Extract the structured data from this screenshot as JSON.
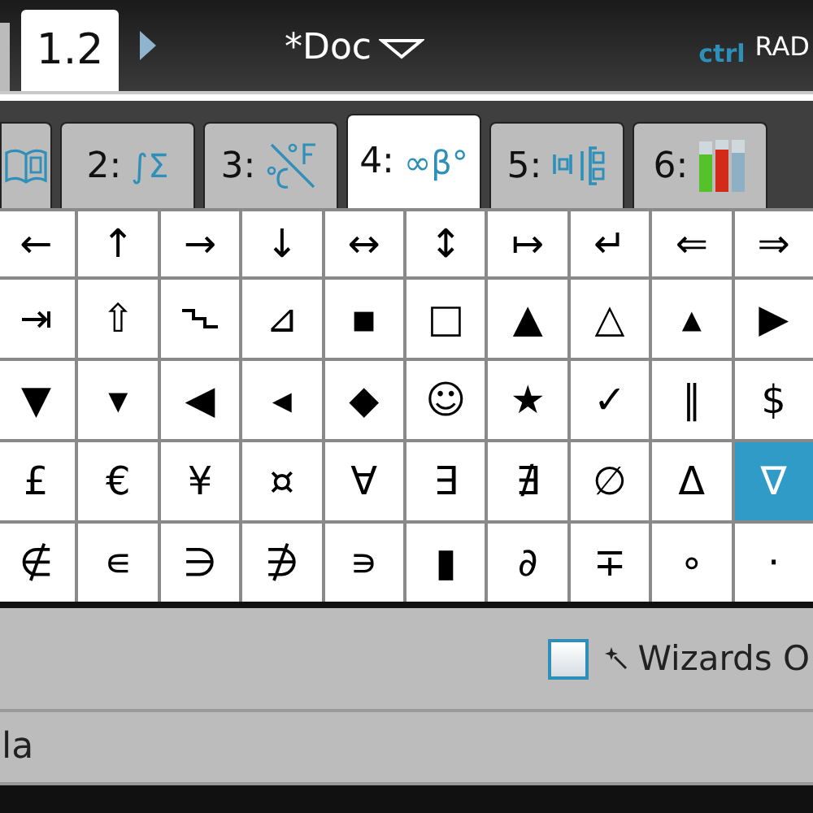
{
  "top_bar": {
    "page_tab": "1.2",
    "document_title": "*Doc",
    "modifier": "ctrl",
    "angle_mode": "RAD"
  },
  "category_tabs": [
    {
      "kind": "book",
      "selected": false
    },
    {
      "kind": "text",
      "number": "2:",
      "symbol": "∫Σ",
      "selected": false
    },
    {
      "kind": "units",
      "number": "3:",
      "selected": false
    },
    {
      "kind": "text",
      "number": "4:",
      "symbol": "∞β°",
      "selected": true
    },
    {
      "kind": "matrix",
      "number": "5:",
      "selected": false
    },
    {
      "kind": "library",
      "number": "6:",
      "selected": false
    }
  ],
  "symbol_grid": [
    [
      {
        "kind": "char",
        "text": "←",
        "selected": false
      },
      {
        "kind": "char",
        "text": "↑",
        "selected": false
      },
      {
        "kind": "char",
        "text": "→",
        "selected": false
      },
      {
        "kind": "char",
        "text": "↓",
        "selected": false
      },
      {
        "kind": "char",
        "text": "↔",
        "selected": false
      },
      {
        "kind": "char",
        "text": "↕",
        "selected": false
      },
      {
        "kind": "char",
        "text": "↦",
        "selected": false
      },
      {
        "kind": "char",
        "text": "↵",
        "selected": false
      },
      {
        "kind": "char",
        "text": "⇐",
        "selected": false
      },
      {
        "kind": "char",
        "text": "⇒",
        "selected": false
      }
    ],
    [
      {
        "kind": "char",
        "text": "⇥",
        "selected": false
      },
      {
        "kind": "char",
        "text": "⇧",
        "selected": false
      },
      {
        "kind": "step",
        "selected": false
      },
      {
        "kind": "char",
        "text": "⊿",
        "selected": false
      },
      {
        "kind": "char",
        "text": "▪",
        "selected": false
      },
      {
        "kind": "char",
        "text": "□",
        "selected": false
      },
      {
        "kind": "char",
        "text": "▲",
        "selected": false
      },
      {
        "kind": "char",
        "text": "△",
        "selected": false
      },
      {
        "kind": "char",
        "text": "▴",
        "selected": false
      },
      {
        "kind": "char",
        "text": "▶",
        "selected": false
      }
    ],
    [
      {
        "kind": "char",
        "text": "▼",
        "selected": false
      },
      {
        "kind": "char",
        "text": "▾",
        "selected": false
      },
      {
        "kind": "char",
        "text": "◀",
        "selected": false
      },
      {
        "kind": "char",
        "text": "◂",
        "selected": false
      },
      {
        "kind": "char",
        "text": "◆",
        "selected": false
      },
      {
        "kind": "char",
        "text": "☺",
        "selected": false
      },
      {
        "kind": "char",
        "text": "★",
        "selected": false
      },
      {
        "kind": "char",
        "text": "✓",
        "selected": false
      },
      {
        "kind": "char",
        "text": "∥",
        "selected": false
      },
      {
        "kind": "char",
        "text": "$",
        "selected": false
      }
    ],
    [
      {
        "kind": "char",
        "text": "£",
        "selected": false
      },
      {
        "kind": "char",
        "text": "€",
        "selected": false
      },
      {
        "kind": "char",
        "text": "¥",
        "selected": false
      },
      {
        "kind": "char",
        "text": "¤",
        "selected": false
      },
      {
        "kind": "char",
        "text": "∀",
        "selected": false
      },
      {
        "kind": "char",
        "text": "∃",
        "selected": false
      },
      {
        "kind": "char",
        "text": "∄",
        "selected": false
      },
      {
        "kind": "char",
        "text": "∅",
        "selected": false
      },
      {
        "kind": "char",
        "text": "Δ",
        "selected": false
      },
      {
        "kind": "char",
        "text": "∇",
        "selected": true
      }
    ],
    [
      {
        "kind": "char",
        "text": "∉",
        "selected": false
      },
      {
        "kind": "char",
        "text": "∊",
        "selected": false
      },
      {
        "kind": "char",
        "text": "∋",
        "selected": false
      },
      {
        "kind": "char",
        "text": "∌",
        "selected": false
      },
      {
        "kind": "char",
        "text": "∍",
        "selected": false
      },
      {
        "kind": "char",
        "text": "▮",
        "selected": false
      },
      {
        "kind": "char",
        "text": "∂",
        "selected": false
      },
      {
        "kind": "char",
        "text": "∓",
        "selected": false
      },
      {
        "kind": "char",
        "text": "∘",
        "selected": false
      },
      {
        "kind": "char",
        "text": "·",
        "selected": false
      }
    ]
  ],
  "wizards": {
    "label": "Wizards O",
    "checked": false
  },
  "status_line": "la"
}
